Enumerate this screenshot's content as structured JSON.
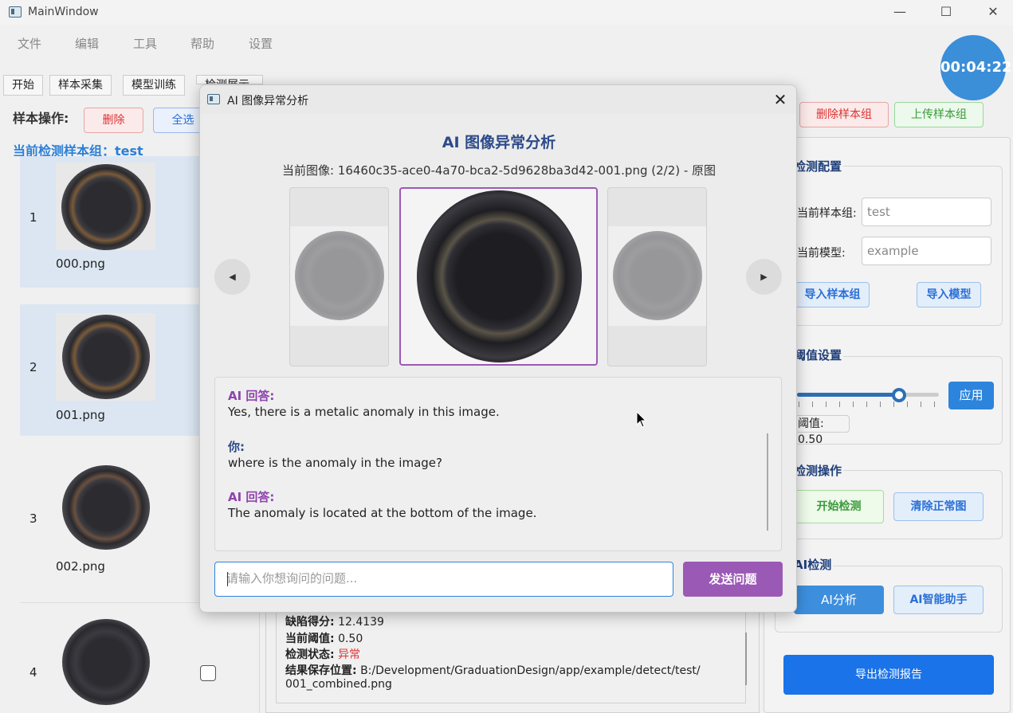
{
  "window": {
    "title": "MainWindow"
  },
  "menu": [
    "文件",
    "编辑",
    "工具",
    "帮助",
    "设置"
  ],
  "timer": "00:04:22",
  "tabs": [
    "开始",
    "样本采集",
    "模型训练",
    "检测展示"
  ],
  "sample_ops": {
    "label": "样本操作:",
    "delete": "删除",
    "select_all": "全选",
    "delete_group": "删除样本组",
    "upload_group": "上传样本组"
  },
  "current_group": "当前检测样本组：test",
  "samples": [
    {
      "index": "1",
      "file": "000.png",
      "selected": true
    },
    {
      "index": "2",
      "file": "001.png",
      "selected": true
    },
    {
      "index": "3",
      "file": "002.png",
      "selected": false
    },
    {
      "index": "4",
      "file": "",
      "selected": false
    }
  ],
  "right_panel": {
    "config": {
      "title": "检测配置",
      "group_label": "当前样本组:",
      "group_value": "test",
      "model_label": "当前模型:",
      "model_value": "example",
      "import_group": "导入样本组",
      "import_model": "导入模型"
    },
    "threshold": {
      "title": "阈值设置",
      "apply": "应用",
      "value_label": "阈值: 0.50",
      "level": 0.72
    },
    "detect_ops": {
      "title": "检测操作",
      "start": "开始检测",
      "clear": "清除正常图"
    },
    "ai": {
      "title": "AI检测",
      "analyze": "AI分析",
      "assistant": "AI智能助手"
    },
    "export": "导出检测报告"
  },
  "result": {
    "score_label": "缺陷得分:",
    "score": "12.4139",
    "threshold_label": "当前阈值:",
    "threshold": "0.50",
    "status_label": "检测状态:",
    "status": "异常",
    "path_label": "结果保存位置:",
    "path1": "B:/Development/GraduationDesign/app/example/detect/test/",
    "path2": "001_combined.png"
  },
  "dialog": {
    "title": "AI 图像异常分析",
    "heading": "AI 图像异常分析",
    "current_image": "当前图像: 16460c35-ace0-4a70-bca2-5d9628ba3d42-001.png (2/2) - 原图",
    "prev": "◀",
    "next": "▶",
    "chat": [
      {
        "speaker": "AI 回答:",
        "text": "Yes, there is a metalic anomaly in this image."
      },
      {
        "speaker": "你:",
        "text": "where is the anomaly in the image?"
      },
      {
        "speaker": "AI 回答:",
        "text": "The anomaly is located at the bottom of the image."
      }
    ],
    "input_placeholder": "请输入你想询问的问题...",
    "send": "发送问题"
  },
  "colors": {
    "accent_blue": "#2d84dc",
    "purple": "#9b59b6",
    "danger": "#dd3333",
    "success": "#3a9a3a"
  }
}
